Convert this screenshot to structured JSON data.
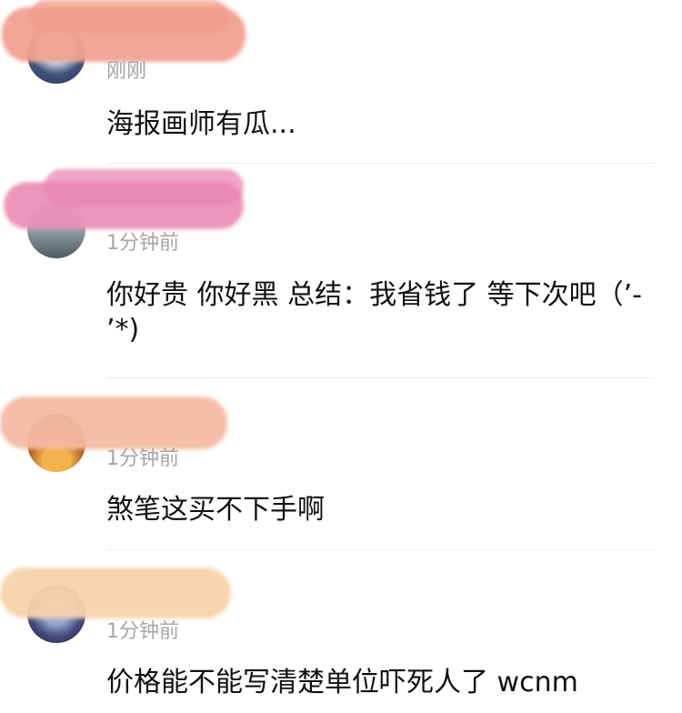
{
  "comments": [
    {
      "time": "刚刚",
      "text": "海报画师有瓜...",
      "avatar_colors": [
        "#b7c3d6",
        "#3d4d6e"
      ],
      "blur_color": "#f0a090"
    },
    {
      "time": "1分钟前",
      "text": "你好贵 你好黑 总结：我省钱了 等下次吧（ʼ-ʼ*)",
      "avatar_colors": [
        "#9aa6ad",
        "#5c6a72"
      ],
      "blur_color": "#ea8fb6"
    },
    {
      "time": "1分钟前",
      "text": "煞笔这买不下手啊",
      "avatar_colors": [
        "#e0a040",
        "#5a2a10"
      ],
      "blur_color": "#f4b9a2"
    },
    {
      "time": "1分钟前",
      "text": "价格能不能写清楚单位吓死人了 wcnm",
      "avatar_colors": [
        "#7f8cc0",
        "#2b2f52"
      ],
      "blur_color": "#f6d2a8"
    }
  ]
}
